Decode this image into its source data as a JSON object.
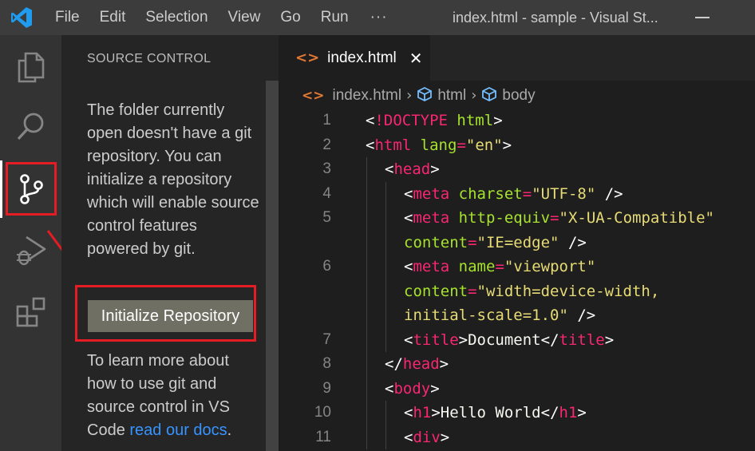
{
  "titlebar": {
    "menu": [
      "File",
      "Edit",
      "Selection",
      "View",
      "Go",
      "Run"
    ],
    "more": "···",
    "window_title": "index.html - sample - Visual St..."
  },
  "activitybar": {
    "items": [
      "explorer-icon",
      "search-icon",
      "source-control-icon",
      "run-debug-icon",
      "extensions-icon"
    ],
    "active": "source-control-icon",
    "highlight_color": "#e51c23"
  },
  "sidebar": {
    "header": "SOURCE CONTROL",
    "message": "The folder currently open doesn't have a git repository. You can initialize a repository which will enable source control features powered by git.",
    "button_label": "Initialize Repository",
    "learn_prefix": "To learn more about how to use git and source control in VS Code ",
    "learn_link": "read our docs",
    "learn_suffix": "."
  },
  "editor": {
    "tab_icon": "<>",
    "tab_label": "index.html",
    "tab_close": "✕",
    "breadcrumb": [
      "index.html",
      "html",
      "body"
    ],
    "lines": [
      {
        "n": "1",
        "indent": 0,
        "tokens": [
          [
            "br",
            "<"
          ],
          [
            "tag",
            "!DOCTYPE"
          ],
          [
            "txt",
            " "
          ],
          [
            "attr",
            "html"
          ],
          [
            "br",
            ">"
          ]
        ]
      },
      {
        "n": "2",
        "indent": 0,
        "tokens": [
          [
            "br",
            "<"
          ],
          [
            "tag",
            "html"
          ],
          [
            "txt",
            " "
          ],
          [
            "attr",
            "lang"
          ],
          [
            "eq",
            "="
          ],
          [
            "str",
            "\"en\""
          ],
          [
            "br",
            ">"
          ]
        ]
      },
      {
        "n": "3",
        "indent": 1,
        "tokens": [
          [
            "br",
            "<"
          ],
          [
            "tag",
            "head"
          ],
          [
            "br",
            ">"
          ]
        ]
      },
      {
        "n": "4",
        "indent": 2,
        "tokens": [
          [
            "br",
            "<"
          ],
          [
            "tag",
            "meta"
          ],
          [
            "txt",
            " "
          ],
          [
            "attr",
            "charset"
          ],
          [
            "eq",
            "="
          ],
          [
            "str",
            "\"UTF-8\""
          ],
          [
            "txt",
            " "
          ],
          [
            "br",
            "/>"
          ]
        ]
      },
      {
        "n": "5",
        "indent": 2,
        "tokens": [
          [
            "br",
            "<"
          ],
          [
            "tag",
            "meta"
          ],
          [
            "txt",
            " "
          ],
          [
            "attr",
            "http-equiv"
          ],
          [
            "eq",
            "="
          ],
          [
            "str",
            "\"X-UA-Compatible\""
          ]
        ]
      },
      {
        "n": "",
        "indent": 2,
        "tokens": [
          [
            "attr",
            "content"
          ],
          [
            "eq",
            "="
          ],
          [
            "str",
            "\"IE=edge\""
          ],
          [
            "txt",
            " "
          ],
          [
            "br",
            "/>"
          ]
        ]
      },
      {
        "n": "6",
        "indent": 2,
        "tokens": [
          [
            "br",
            "<"
          ],
          [
            "tag",
            "meta"
          ],
          [
            "txt",
            " "
          ],
          [
            "attr",
            "name"
          ],
          [
            "eq",
            "="
          ],
          [
            "str",
            "\"viewport\""
          ]
        ]
      },
      {
        "n": "",
        "indent": 2,
        "tokens": [
          [
            "attr",
            "content"
          ],
          [
            "eq",
            "="
          ],
          [
            "str",
            "\"width=device-width,"
          ]
        ]
      },
      {
        "n": "",
        "indent": 2,
        "tokens": [
          [
            "str",
            "initial-scale=1.0\""
          ],
          [
            "txt",
            " "
          ],
          [
            "br",
            "/>"
          ]
        ]
      },
      {
        "n": "7",
        "indent": 2,
        "tokens": [
          [
            "br",
            "<"
          ],
          [
            "tag",
            "title"
          ],
          [
            "br",
            ">"
          ],
          [
            "txt",
            "Document"
          ],
          [
            "br",
            "</"
          ],
          [
            "tag",
            "title"
          ],
          [
            "br",
            ">"
          ]
        ]
      },
      {
        "n": "8",
        "indent": 1,
        "tokens": [
          [
            "br",
            "</"
          ],
          [
            "tag",
            "head"
          ],
          [
            "br",
            ">"
          ]
        ]
      },
      {
        "n": "9",
        "indent": 1,
        "tokens": [
          [
            "br",
            "<"
          ],
          [
            "tag",
            "body"
          ],
          [
            "br",
            ">"
          ]
        ]
      },
      {
        "n": "10",
        "indent": 2,
        "tokens": [
          [
            "br",
            "<"
          ],
          [
            "tag",
            "h1"
          ],
          [
            "br",
            ">"
          ],
          [
            "txt",
            "Hello World"
          ],
          [
            "br",
            "</"
          ],
          [
            "tag",
            "h1"
          ],
          [
            "br",
            ">"
          ]
        ]
      },
      {
        "n": "11",
        "indent": 2,
        "tokens": [
          [
            "br",
            "<"
          ],
          [
            "tag",
            "div"
          ],
          [
            "br",
            ">"
          ]
        ]
      }
    ]
  }
}
